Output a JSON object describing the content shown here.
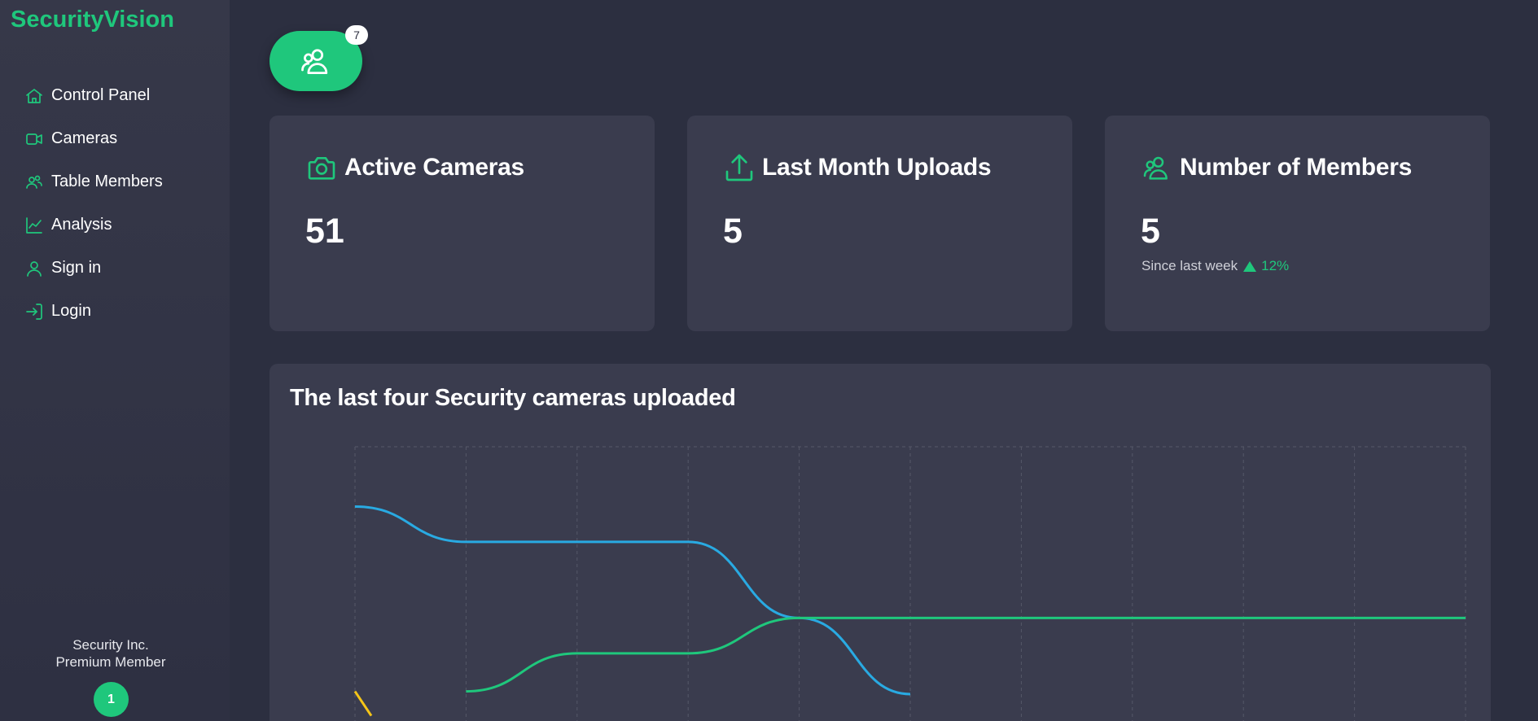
{
  "brand": "SecurityVision",
  "sidebar": {
    "items": [
      {
        "label": "Control Panel",
        "icon": "home-icon"
      },
      {
        "label": "Cameras",
        "icon": "video-icon"
      },
      {
        "label": "Table Members",
        "icon": "users-icon"
      },
      {
        "label": "Analysis",
        "icon": "chart-line-icon"
      },
      {
        "label": "Sign in",
        "icon": "user-icon"
      },
      {
        "label": "Login",
        "icon": "login-icon"
      }
    ],
    "footer_company": "Security Inc.",
    "footer_tier": "Premium Member",
    "footer_badge": "1"
  },
  "header": {
    "fab_icon": "users-icon",
    "fab_badge": "7"
  },
  "cards": [
    {
      "title": "Active Cameras",
      "value": "51",
      "icon": "camera-icon"
    },
    {
      "title": "Last Month Uploads",
      "value": "5",
      "icon": "upload-icon"
    },
    {
      "title": "Number of Members",
      "value": "5",
      "icon": "users-icon",
      "note": "Since last week",
      "change": "12%"
    }
  ],
  "chart": {
    "title": "The last four Security cameras uploaded"
  },
  "colors": {
    "accent": "#1fc77c",
    "background": "#2c2f40",
    "card": "#3a3c4e",
    "series_blue": "#29aae2",
    "series_green": "#1fc77c",
    "series_yellow": "#f5c518"
  },
  "chart_data": {
    "type": "line",
    "title": "The last four Security cameras uploaded",
    "x": [
      0,
      1,
      2,
      3,
      4,
      5,
      6,
      7,
      8,
      9,
      10
    ],
    "grid": true,
    "series": [
      {
        "color": "#29aae2",
        "values": [
          7.8,
          6.5,
          6.5,
          6.5,
          3.7,
          0.9,
          null,
          null,
          null,
          null,
          null
        ]
      },
      {
        "color": "#1fc77c",
        "values": [
          null,
          1.0,
          2.4,
          2.4,
          3.7,
          3.7,
          3.7,
          3.7,
          3.7,
          3.7,
          3.7
        ]
      },
      {
        "color": "#f5c518",
        "values": [
          1.0,
          null,
          null,
          null,
          null,
          null,
          null,
          null,
          null,
          null,
          null
        ]
      }
    ],
    "ylim": [
      0,
      10
    ]
  }
}
